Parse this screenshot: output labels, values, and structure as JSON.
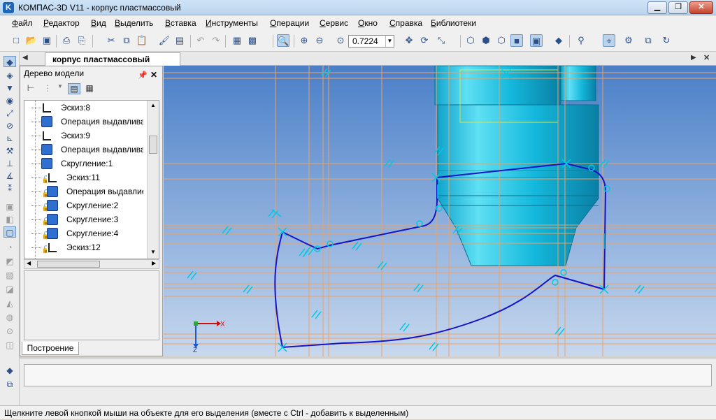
{
  "window": {
    "app_icon_letter": "K",
    "title": "КОМПАС-3D V11 - корпус пластмассовый",
    "min_glyph": "▁",
    "max_glyph": "❐",
    "close_glyph": "✕"
  },
  "menu": {
    "items": [
      "Файл",
      "Редактор",
      "Вид",
      "Выделить",
      "Вставка",
      "Инструменты",
      "Операции",
      "Сервис",
      "Окно",
      "Справка",
      "Библиотеки"
    ]
  },
  "toolbar": {
    "zoom_value": "0.7224"
  },
  "document_tab": {
    "label": "корпус пластмассовый"
  },
  "model_tree": {
    "title": "Дерево модели",
    "rows": [
      {
        "label": "Эскиз:8",
        "kind": "sketch",
        "locked": false
      },
      {
        "label": "Операция выдавлива",
        "kind": "extrude",
        "locked": false
      },
      {
        "label": "Эскиз:9",
        "kind": "sketch",
        "locked": false
      },
      {
        "label": "Операция выдавлива",
        "kind": "extrude",
        "locked": false
      },
      {
        "label": "Скругление:1",
        "kind": "fillet",
        "locked": false
      },
      {
        "label": "Эскиз:11",
        "kind": "sketch",
        "locked": true
      },
      {
        "label": "Операция выдавлие",
        "kind": "extrude",
        "locked": true
      },
      {
        "label": "Скругление:2",
        "kind": "fillet",
        "locked": true
      },
      {
        "label": "Скругление:3",
        "kind": "fillet",
        "locked": true
      },
      {
        "label": "Скругление:4",
        "kind": "fillet",
        "locked": true
      },
      {
        "label": "Эскиз:12",
        "kind": "sketch",
        "locked": true
      }
    ],
    "bottom_tab": "Построение"
  },
  "viewport": {
    "axis_x": "X",
    "axis_z": "Z",
    "colors": {
      "background_top": "#4a7fc8",
      "background_bottom": "#c7d8ee",
      "grid": "#f0a060",
      "body": "#10b4d8",
      "sketch": "#1414c8",
      "constraint": "#00c8e6"
    }
  },
  "status": {
    "message": "Щелкните левой кнопкой мыши на объекте для его выделения (вместе с Ctrl - добавить к выделенным)"
  }
}
